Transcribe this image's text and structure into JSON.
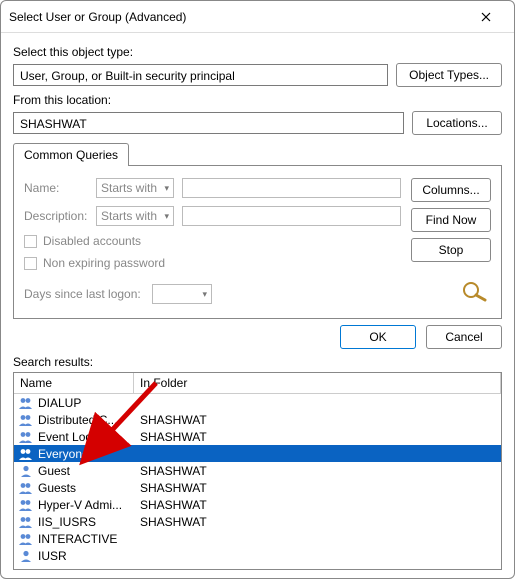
{
  "title": "Select User or Group (Advanced)",
  "objectTypeLabel": "Select this object type:",
  "objectTypeValue": "User, Group, or Built-in security principal",
  "objectTypesButton": "Object Types...",
  "locationLabel": "From this location:",
  "locationValue": "SHASHWAT",
  "locationsButton": "Locations...",
  "tabLabel": "Common Queries",
  "filters": {
    "nameLabel": "Name:",
    "descLabel": "Description:",
    "comboValue": "Starts with",
    "disabled": "Disabled accounts",
    "nonExpire": "Non expiring password",
    "daysSince": "Days since last logon:"
  },
  "sideButtons": {
    "columns": "Columns...",
    "findNow": "Find Now",
    "stop": "Stop"
  },
  "okButton": "OK",
  "cancelButton": "Cancel",
  "searchResultsLabel": "Search results:",
  "columns": {
    "name": "Name",
    "folder": "In Folder"
  },
  "rows": [
    {
      "icon": "group",
      "name": "DIALUP",
      "folder": "",
      "sel": false
    },
    {
      "icon": "group",
      "name": "Distributed C...",
      "folder": "SHASHWAT",
      "sel": false
    },
    {
      "icon": "group",
      "name": "Event Log Re...",
      "folder": "SHASHWAT",
      "sel": false
    },
    {
      "icon": "group",
      "name": "Everyone",
      "folder": "",
      "sel": true
    },
    {
      "icon": "user",
      "name": "Guest",
      "folder": "SHASHWAT",
      "sel": false
    },
    {
      "icon": "group",
      "name": "Guests",
      "folder": "SHASHWAT",
      "sel": false
    },
    {
      "icon": "group",
      "name": "Hyper-V Admi...",
      "folder": "SHASHWAT",
      "sel": false
    },
    {
      "icon": "group",
      "name": "IIS_IUSRS",
      "folder": "SHASHWAT",
      "sel": false
    },
    {
      "icon": "group",
      "name": "INTERACTIVE",
      "folder": "",
      "sel": false
    },
    {
      "icon": "user",
      "name": "IUSR",
      "folder": "",
      "sel": false
    }
  ]
}
